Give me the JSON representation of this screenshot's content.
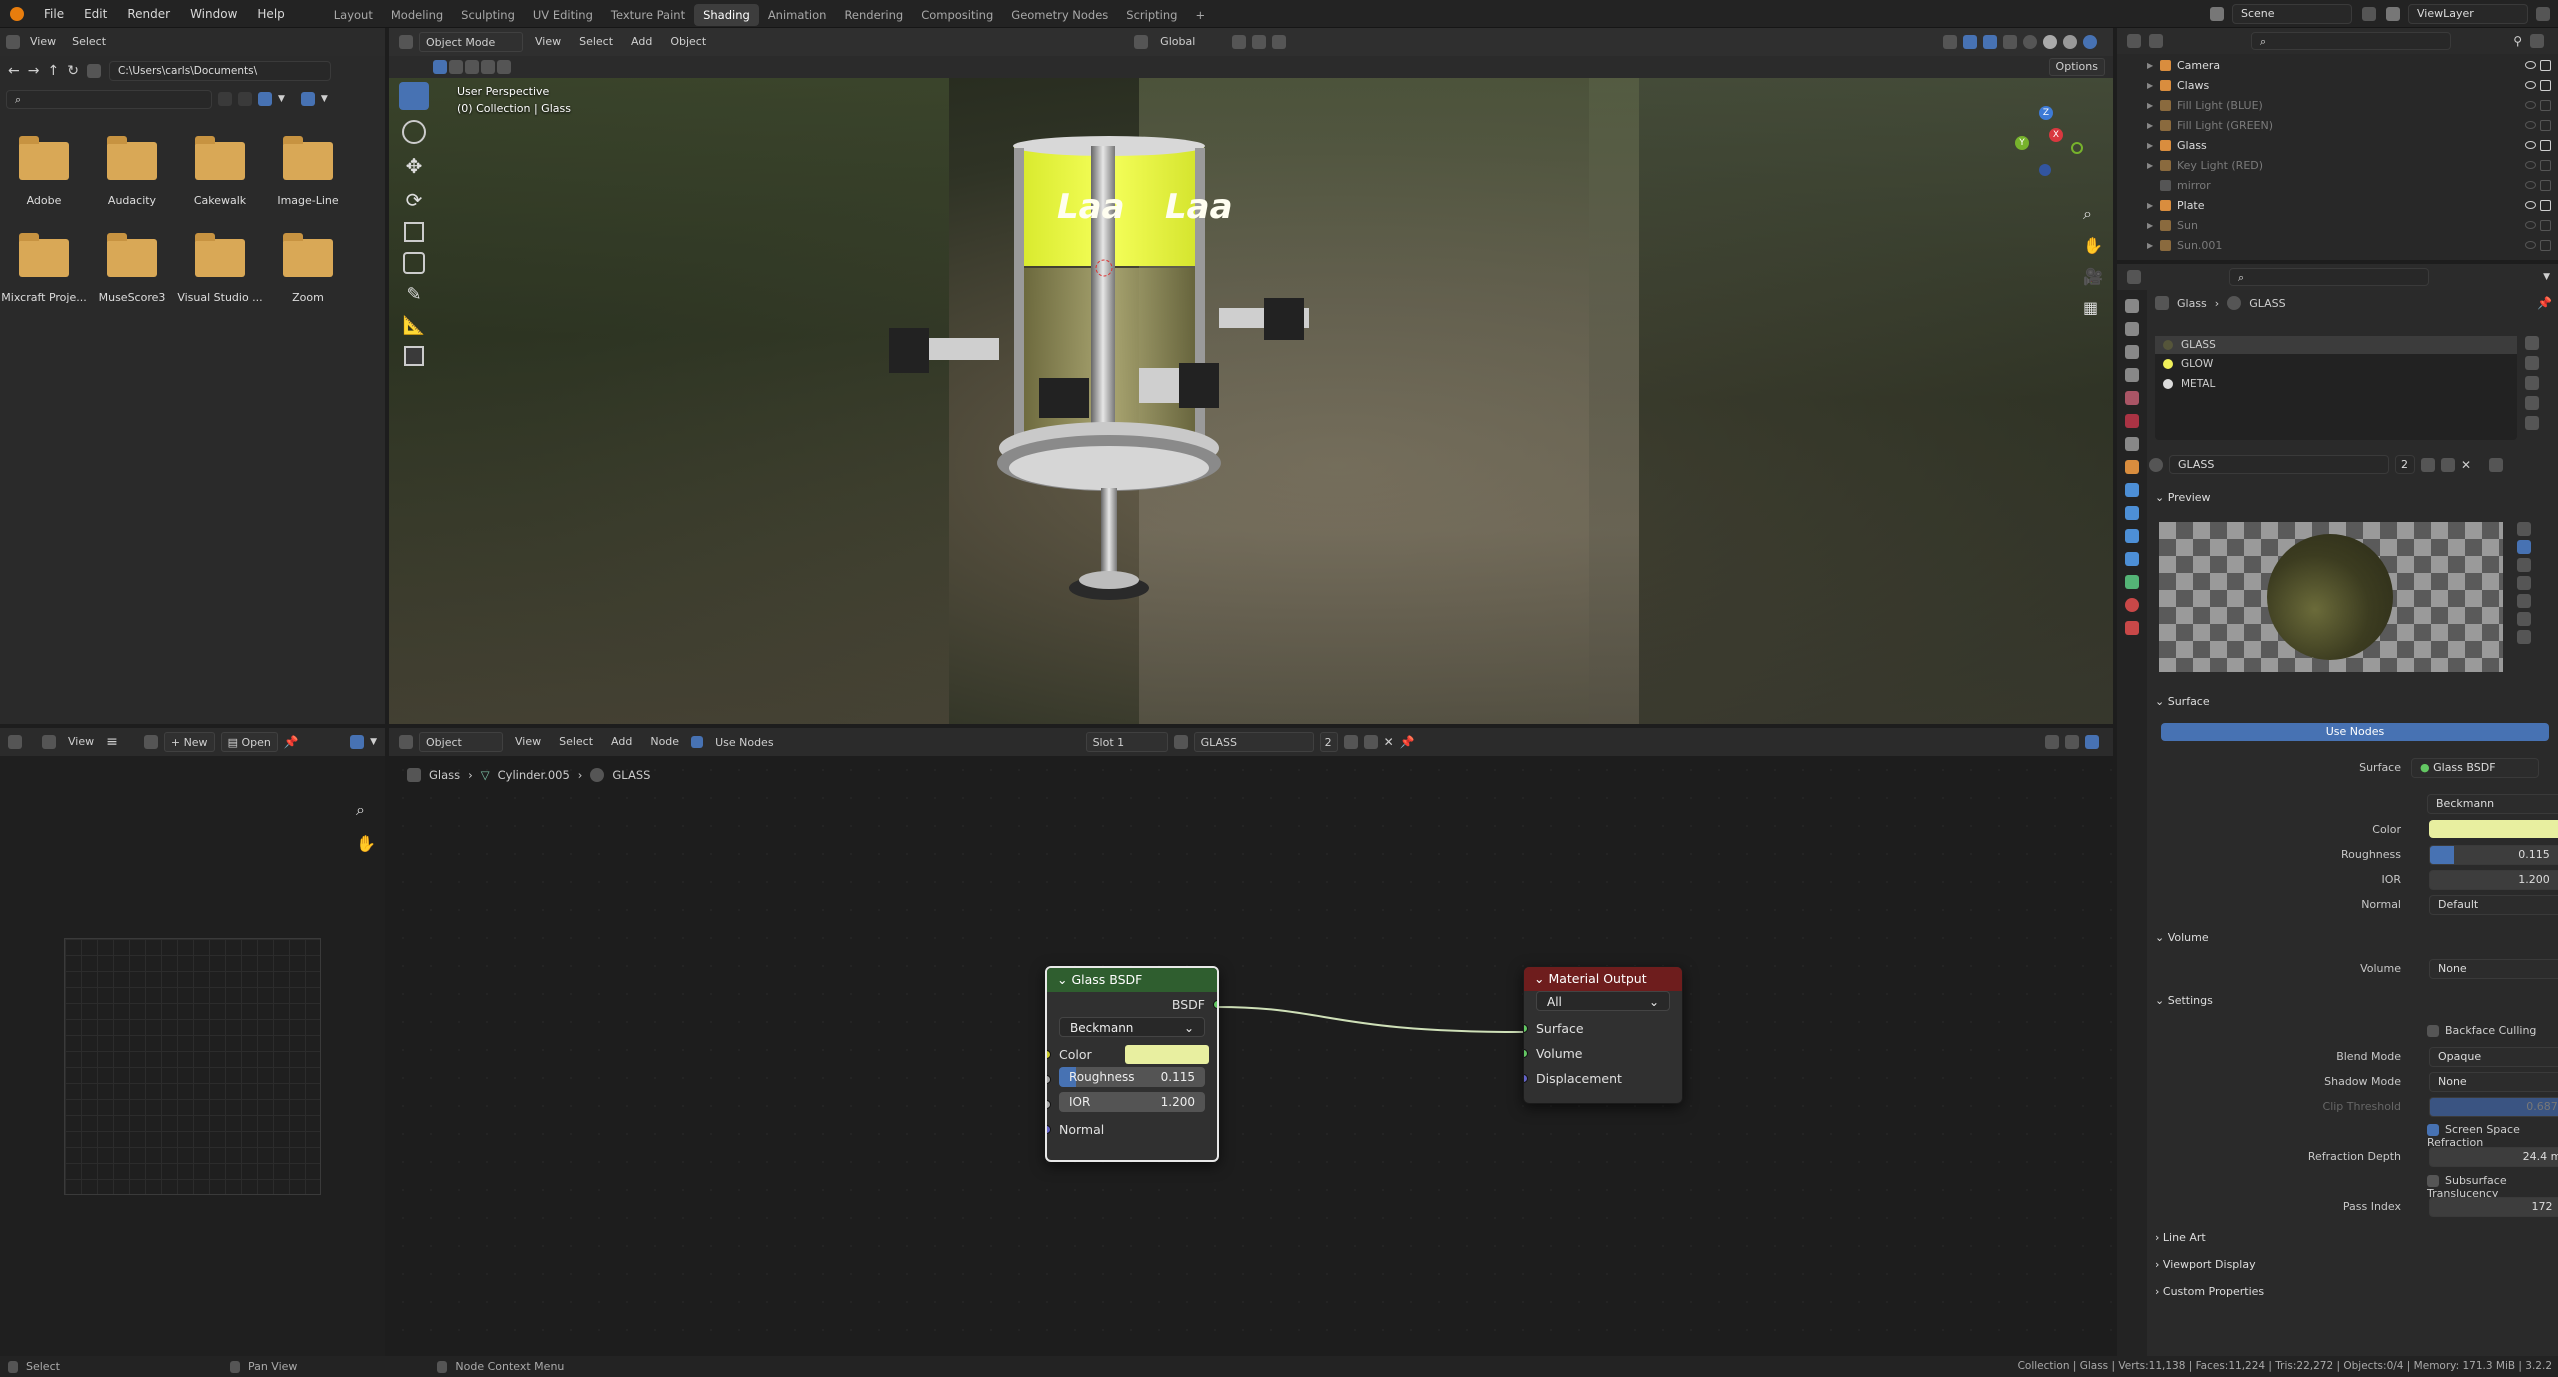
{
  "topbar": {
    "menus": [
      "File",
      "Edit",
      "Render",
      "Window",
      "Help"
    ],
    "workspaces": [
      "Layout",
      "Modeling",
      "Sculpting",
      "UV Editing",
      "Texture Paint",
      "Shading",
      "Animation",
      "Rendering",
      "Compositing",
      "Geometry Nodes",
      "Scripting"
    ],
    "active_workspace": "Shading",
    "add_tab": "+",
    "scene": "Scene",
    "view_layer": "ViewLayer"
  },
  "file_browser": {
    "menu_view": "View",
    "menu_select": "Select",
    "path": "C:\\Users\\carls\\Documents\\",
    "folders": [
      "Adobe",
      "Audacity",
      "Cakewalk",
      "Image-Line",
      "Mixcraft Proje...",
      "MuseScore3",
      "Visual Studio ...",
      "Zoom"
    ]
  },
  "viewport": {
    "mode": "Object Mode",
    "menus": [
      "View",
      "Select",
      "Add",
      "Object"
    ],
    "orientation": "Global",
    "options": "Options",
    "overlay_line1": "User Perspective",
    "overlay_line2": "(0) Collection | Glass",
    "can_text_1": "Laa",
    "can_text_2": "Laa",
    "gizmo_x": "X",
    "gizmo_y": "Y",
    "gizmo_z": "Z"
  },
  "image_editor": {
    "view": "View",
    "new": "New",
    "open": "Open"
  },
  "node_editor": {
    "type": "Object",
    "menus": [
      "View",
      "Select",
      "Add",
      "Node"
    ],
    "use_nodes": "Use Nodes",
    "slot": "Slot 1",
    "material": "GLASS",
    "users": "2",
    "breadcrumb": [
      "Glass",
      "Cylinder.005",
      "GLASS"
    ],
    "glass_node": {
      "title": "Glass BSDF",
      "output": "BSDF",
      "distribution": "Beckmann",
      "color_label": "Color",
      "color": "#e8efa0",
      "roughness_label": "Roughness",
      "roughness": "0.115",
      "ior_label": "IOR",
      "ior": "1.200",
      "normal_label": "Normal"
    },
    "output_node": {
      "title": "Material Output",
      "target": "All",
      "inputs": [
        "Surface",
        "Volume",
        "Displacement"
      ]
    }
  },
  "outliner": {
    "items": [
      {
        "name": "Camera",
        "dim": false,
        "color": "#d98d3e"
      },
      {
        "name": "Claws",
        "dim": false,
        "color": "#d98d3e"
      },
      {
        "name": "Fill Light (BLUE)",
        "dim": true,
        "color": "#8a6a3e"
      },
      {
        "name": "Fill Light (GREEN)",
        "dim": true,
        "color": "#8a6a3e"
      },
      {
        "name": "Glass",
        "dim": false,
        "color": "#d98d3e"
      },
      {
        "name": "Key Light (RED)",
        "dim": true,
        "color": "#8a6a3e"
      },
      {
        "name": "mirror",
        "dim": true,
        "color": "#666666"
      },
      {
        "name": "Plate",
        "dim": false,
        "color": "#d98d3e"
      },
      {
        "name": "Sun",
        "dim": true,
        "color": "#8a6a3e"
      },
      {
        "name": "Sun.001",
        "dim": true,
        "color": "#8a6a3e"
      }
    ]
  },
  "properties": {
    "breadcrumb_object": "Glass",
    "breadcrumb_material": "GLASS",
    "slots": [
      "GLASS",
      "GLOW",
      "METAL"
    ],
    "material_name": "GLASS",
    "users": "2",
    "preview": "Preview",
    "surface_section": "Surface",
    "use_nodes": "Use Nodes",
    "surface_label": "Surface",
    "surface_value": "Glass BSDF",
    "distribution": "Beckmann",
    "color_label": "Color",
    "roughness_label": "Roughness",
    "roughness": "0.115",
    "ior_label": "IOR",
    "ior": "1.200",
    "normal_label": "Normal",
    "normal_value": "Default",
    "volume_section": "Volume",
    "volume_label": "Volume",
    "volume_value": "None",
    "settings_section": "Settings",
    "backface_culling": "Backface Culling",
    "blend_mode_label": "Blend Mode",
    "blend_mode": "Opaque",
    "shadow_mode_label": "Shadow Mode",
    "shadow_mode": "None",
    "clip_threshold_label": "Clip Threshold",
    "clip_threshold": "0.687",
    "screen_space_refraction": "Screen Space Refraction",
    "refraction_depth_label": "Refraction Depth",
    "refraction_depth": "24.4 m",
    "subsurface_translucency": "Subsurface Translucency",
    "pass_index_label": "Pass Index",
    "pass_index": "172",
    "line_art": "Line Art",
    "viewport_display": "Viewport Display",
    "custom_properties": "Custom Properties"
  },
  "status": {
    "select": "Select",
    "pan": "Pan View",
    "context": "Node Context Menu",
    "stats": "Collection | Glass | Verts:11,138 | Faces:11,224 | Tris:22,272 | Objects:0/4 | Memory: 171.3 MiB | 3.2.2"
  }
}
